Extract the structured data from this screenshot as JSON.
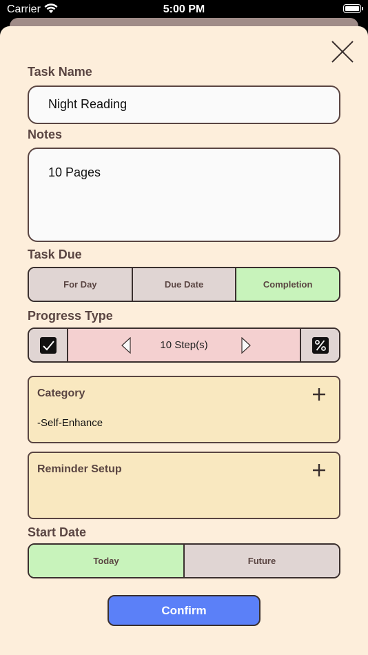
{
  "status_bar": {
    "carrier": "Carrier",
    "time": "5:00 PM"
  },
  "form": {
    "task_name_label": "Task Name",
    "task_name_value": "Night Reading",
    "notes_label": "Notes",
    "notes_value": "10 Pages",
    "task_due_label": "Task Due",
    "task_due_options": [
      "For Day",
      "Due Date",
      "Completion"
    ],
    "task_due_selected": "Completion",
    "progress_type_label": "Progress Type",
    "progress_value": "10 Step(s)",
    "category_title": "Category",
    "category_value": "-Self-Enhance",
    "reminder_title": "Reminder Setup",
    "start_date_label": "Start Date",
    "start_date_options": [
      "Today",
      "Future"
    ],
    "start_date_selected": "Today",
    "confirm_label": "Confirm"
  },
  "colors": {
    "sheet_background": "#fdeedb",
    "active_segment": "#c8f3bb",
    "inactive_segment": "#e0d5d3",
    "progress_background": "#f4d0d0",
    "card_background": "#f9e8c0",
    "confirm_button": "#5b80f8",
    "label_text": "#5a4542"
  },
  "icons": {
    "close": "close-icon",
    "checkbox": "checkbox-checked-icon",
    "percent": "percent-icon",
    "prev": "triangle-left-icon",
    "next": "triangle-right-icon",
    "add": "plus-icon",
    "wifi": "wifi-icon",
    "battery": "battery-icon"
  }
}
